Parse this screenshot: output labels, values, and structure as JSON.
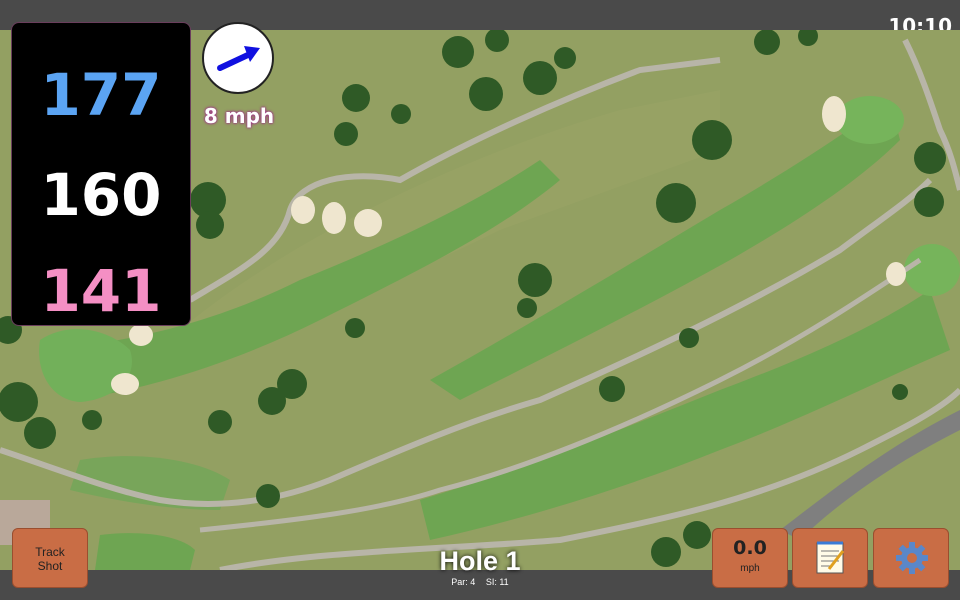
{
  "status_bar": {
    "time": "10:10"
  },
  "distances": {
    "back": "177",
    "middle": "160",
    "front": "141"
  },
  "wind": {
    "speed": "8 mph",
    "arrow_icon": "arrow-icon"
  },
  "hole": {
    "title": "Hole 1",
    "par": "Par: 4",
    "stroke_index": "SI: 11"
  },
  "buttons": {
    "track_shot": {
      "line1": "Track",
      "line2": "Shot"
    },
    "speed": {
      "value": "0.0",
      "unit": "mph"
    },
    "notes_icon": "notepad-icon",
    "settings_icon": "gear-icon"
  },
  "colors": {
    "back_distance": "#5ba4f3",
    "middle_distance": "#ffffff",
    "front_distance": "#f48fc4",
    "button": "#c96d45"
  }
}
